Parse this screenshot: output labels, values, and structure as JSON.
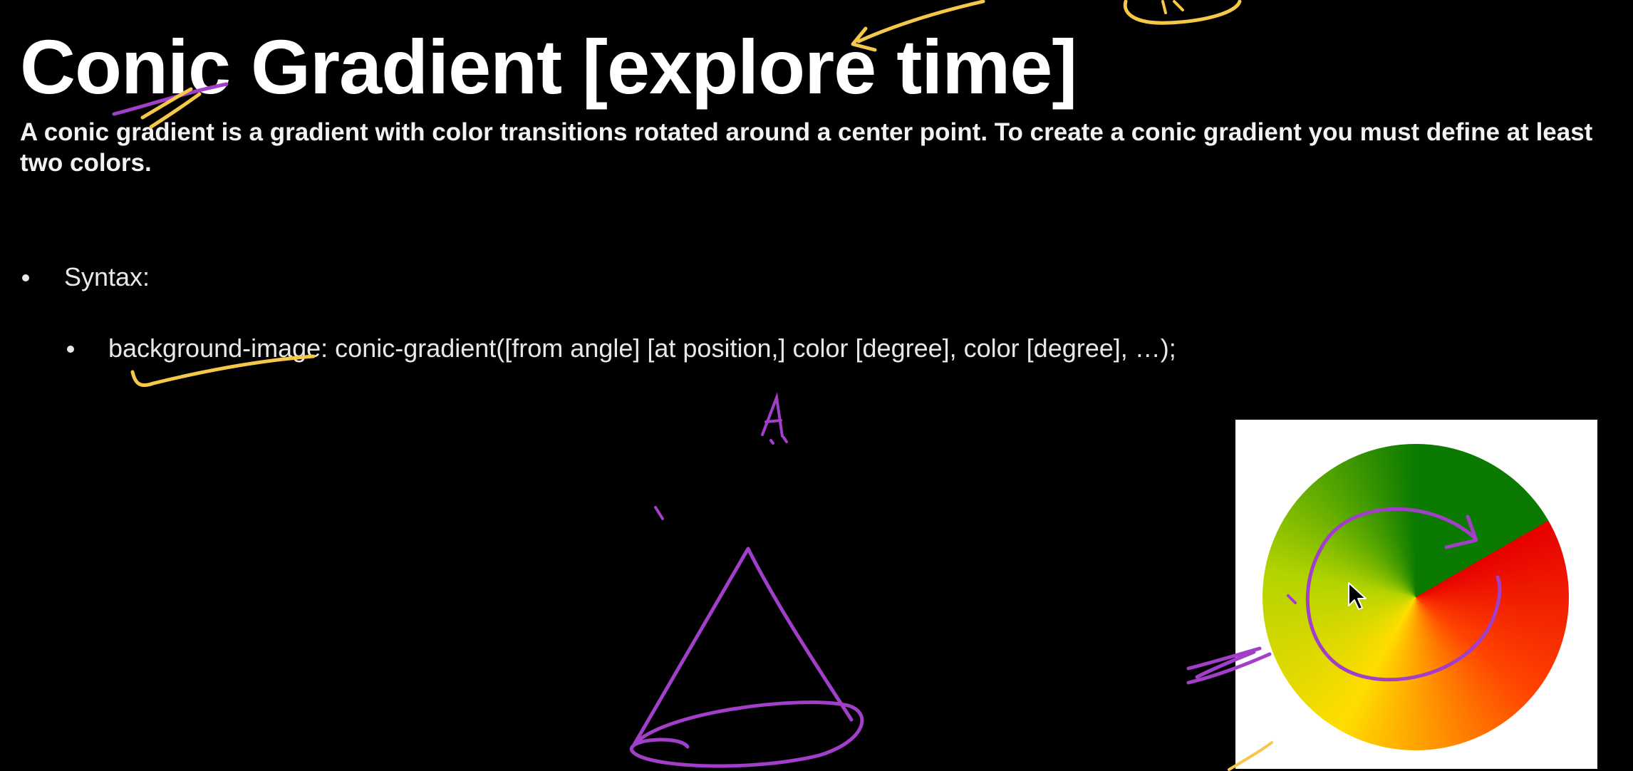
{
  "slide": {
    "title": "Conic Gradient [explore time]",
    "description": "A conic gradient is a gradient with color transitions rotated around a center point. To create a conic gradient you must define at least two colors.",
    "bullets": {
      "syntax_label": "Syntax:",
      "syntax_code": "background-image: conic-gradient([from angle] [at position,] color [degree], color [degree], …);"
    }
  },
  "colors": {
    "background": "#000000",
    "text": "#ffffff",
    "annotation_yellow": "#f5c84a",
    "annotation_purple": "#a23fc9",
    "demo_red": "#e60000",
    "demo_yellow": "#ffdd00",
    "demo_green": "#0a7a00"
  },
  "icons": {
    "cursor": "mouse-pointer-icon"
  }
}
